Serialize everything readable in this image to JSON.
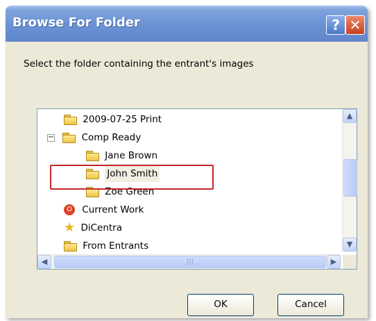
{
  "dialog": {
    "title": "Browse For Folder",
    "help_label": "?",
    "close_label": "✕",
    "instruction": "Select the folder containing the entrant's images"
  },
  "tree": {
    "items": [
      {
        "label": "2009-07-25 Print"
      },
      {
        "label": "Comp Ready",
        "expander": "−"
      },
      {
        "label": "Jane Brown"
      },
      {
        "label": "John Smith",
        "selected": true
      },
      {
        "label": "Zoe Green"
      },
      {
        "label": "Current Work",
        "icon": "red-app-icon"
      },
      {
        "label": "DiCentra",
        "icon": "star-icon"
      },
      {
        "label": "From Entrants"
      }
    ]
  },
  "scrollbars": {
    "up": "▲",
    "down": "▼",
    "left": "◀",
    "right": "▶",
    "thumb_grip": "|||"
  },
  "buttons": {
    "ok": "OK",
    "cancel": "Cancel"
  },
  "colors": {
    "title_bar": "#6a92d4",
    "highlight_border": "#c3272c"
  }
}
